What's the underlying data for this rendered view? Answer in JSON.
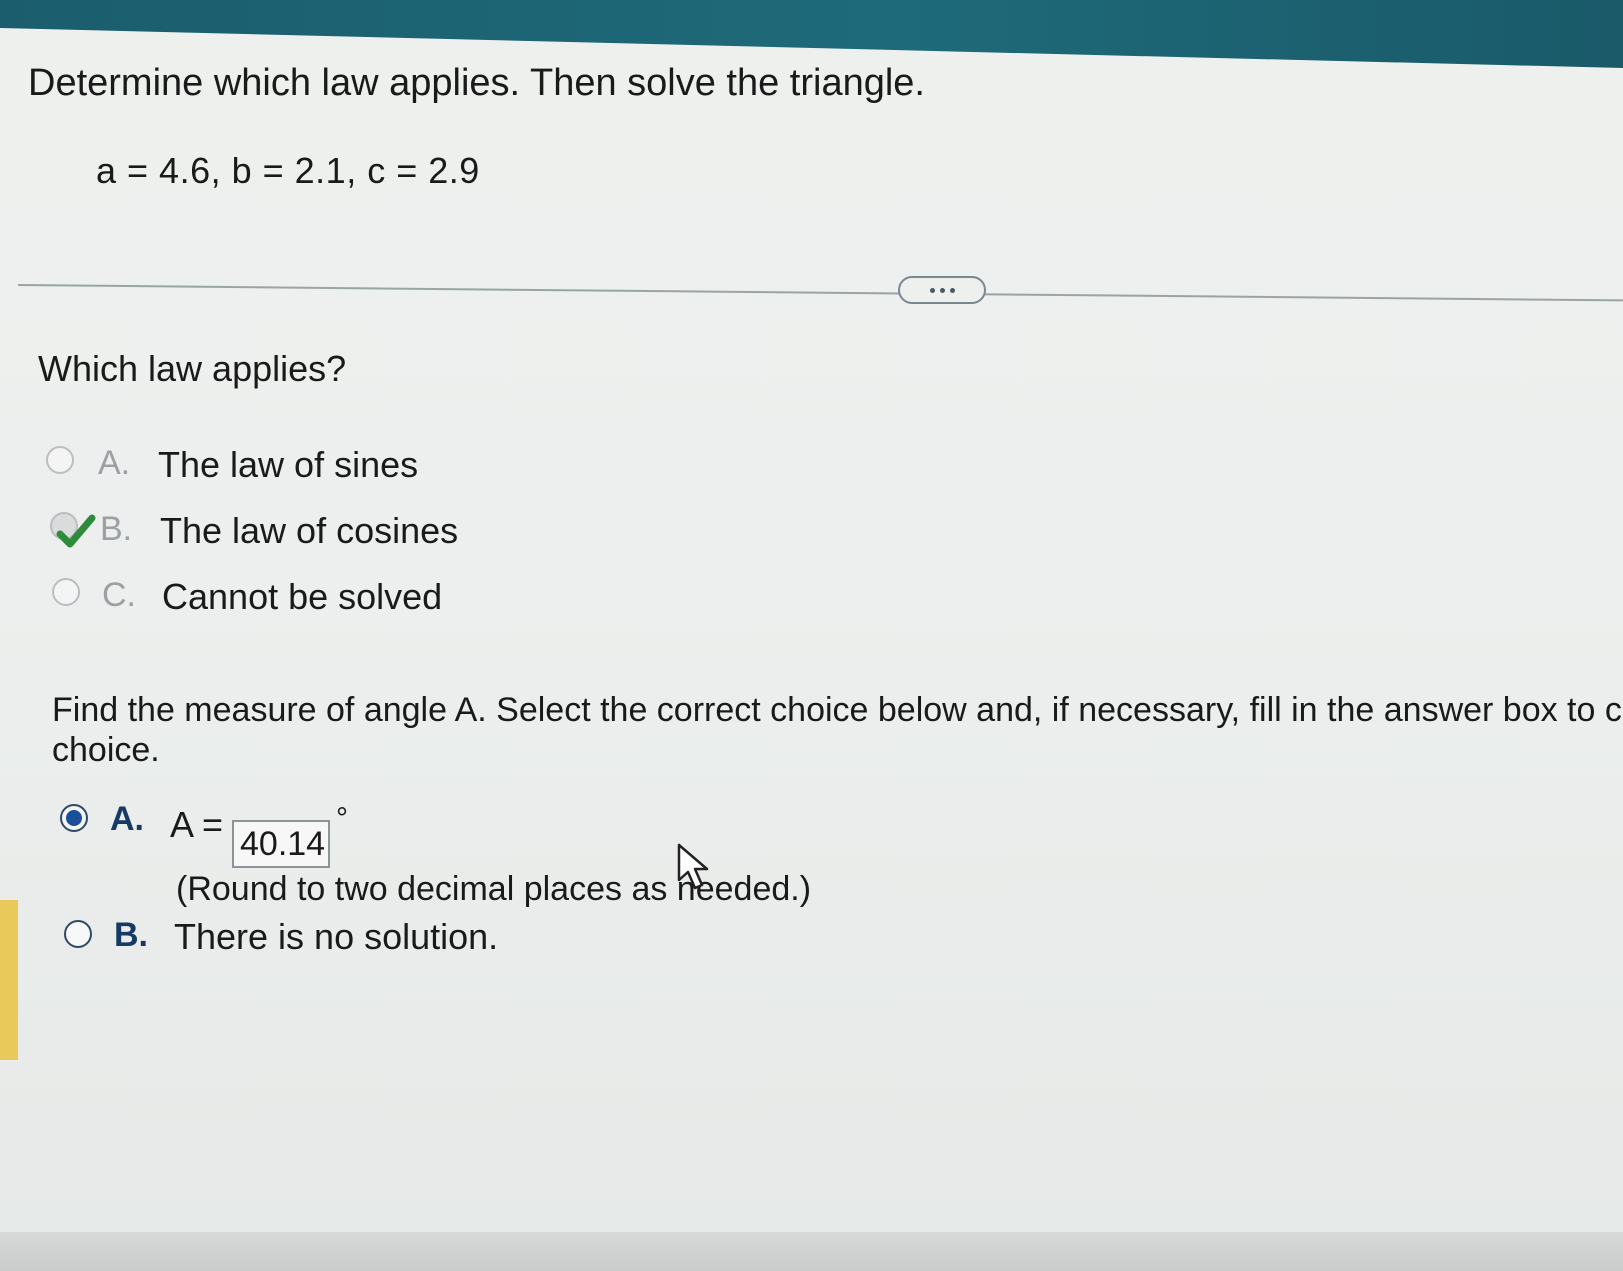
{
  "question": {
    "title": "Determine which law applies. Then solve the triangle.",
    "given": "a = 4.6, b = 2.1, c = 2.9"
  },
  "toolbar": {
    "more_icon": "ellipsis-icon"
  },
  "q1": {
    "prompt": "Which law applies?",
    "options": [
      {
        "letter": "A.",
        "text": "The law of sines",
        "selected": false
      },
      {
        "letter": "B.",
        "text": "The law of cosines",
        "selected": true,
        "marked_correct": true
      },
      {
        "letter": "C.",
        "text": "Cannot be solved",
        "selected": false
      }
    ]
  },
  "q2": {
    "prompt_line1": "Find the measure of angle A. Select the correct choice below and, if necessary, fill in the answer box to c",
    "prompt_line2": "choice.",
    "options": [
      {
        "letter": "A.",
        "prefix": "A =",
        "answer_value": "40.14",
        "unit": "°",
        "hint": "(Round to two decimal places as needed.)",
        "selected": true
      },
      {
        "letter": "B.",
        "text": "There is no solution.",
        "selected": false
      }
    ]
  },
  "colors": {
    "header_teal": "#1e6a7a",
    "selected_radio": "#1a4f9c",
    "correct_check": "#2e8b3a"
  }
}
